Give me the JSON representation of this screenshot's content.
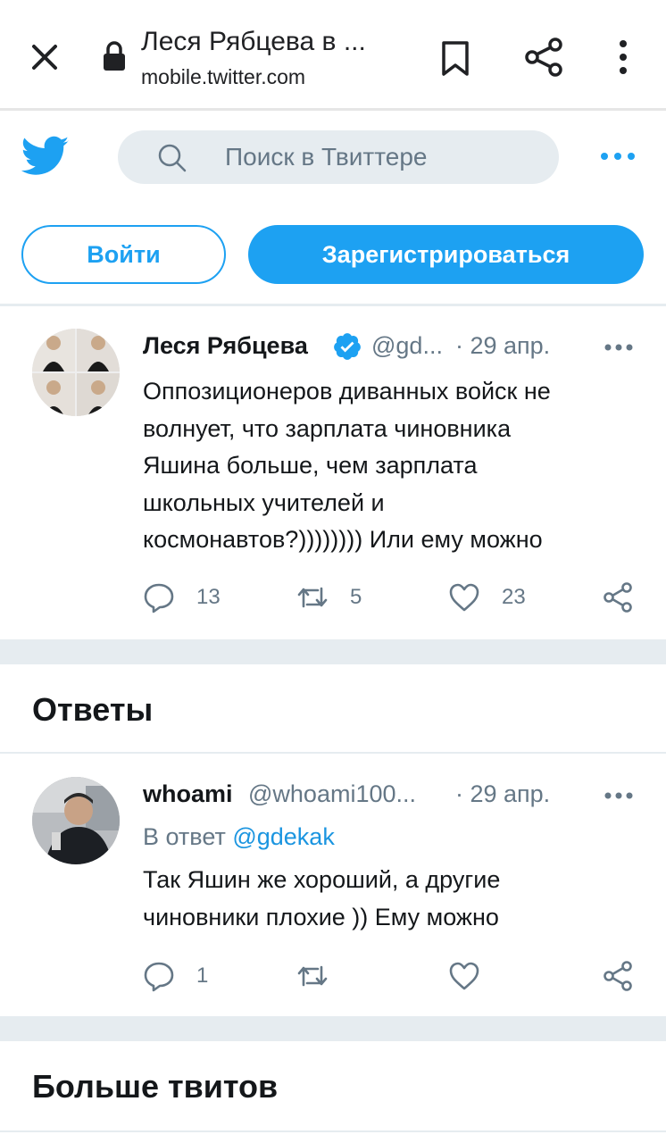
{
  "browser": {
    "title": "Леся Рябцева в ...",
    "url": "mobile.twitter.com"
  },
  "header": {
    "search_placeholder": "Поиск в Твиттере",
    "login_label": "Войти",
    "signup_label": "Зарегистрироваться"
  },
  "tweet": {
    "author_name": "Леся Рябцева",
    "handle": "@gd...",
    "date": "· 29 апр.",
    "text_lines": [
      "Оппозиционеров диванных войск не",
      "волнует, что зарплата чиновника",
      "Яшина больше, чем зарплата",
      "школьных учителей и",
      "космонавтов?)))))))) Или ему можно"
    ],
    "replies": "13",
    "retweets": "5",
    "likes": "23"
  },
  "replies_section": {
    "title": "Ответы"
  },
  "reply": {
    "author_name": "whoami",
    "handle": "@whoami100...",
    "date": "· 29 апр.",
    "reply_to_prefix": "В ответ",
    "reply_to_mention": "@gdekak",
    "text_lines": [
      "Так Яшин же хороший, а другие",
      "чиновники плохие )) Ему можно"
    ],
    "replies": "1"
  },
  "more_section": {
    "title": "Больше твитов"
  },
  "colors": {
    "twitter_blue": "#1da1f2",
    "link_blue": "#1b95e0",
    "muted": "#657786",
    "divider": "#e6ecf0"
  },
  "icons": [
    "close-icon",
    "lock-icon",
    "bookmark-icon",
    "share-icon",
    "more-vertical-icon",
    "twitter-bird-icon",
    "search-icon",
    "more-horizontal-icon",
    "verified-icon",
    "reply-icon",
    "retweet-icon",
    "like-icon"
  ]
}
